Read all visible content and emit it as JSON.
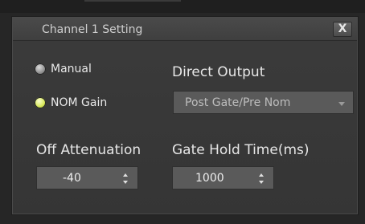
{
  "dialog": {
    "title": "Channel 1 Setting",
    "close_label": "X"
  },
  "mode": {
    "manual_label": "Manual",
    "nom_gain_label": "NOM Gain",
    "selected": "NOM Gain"
  },
  "direct_output": {
    "label": "Direct Output",
    "value": "Post Gate/Pre Nom"
  },
  "off_attenuation": {
    "label": "Off Attenuation",
    "value": "-40"
  },
  "gate_hold_time": {
    "label": "Gate Hold Time(ms)",
    "value": "1000"
  },
  "colors": {
    "background": "#3b3b3b",
    "active_radio": "#d7e85a",
    "field": "#5a5a5a",
    "text": "#e6e6e6"
  }
}
